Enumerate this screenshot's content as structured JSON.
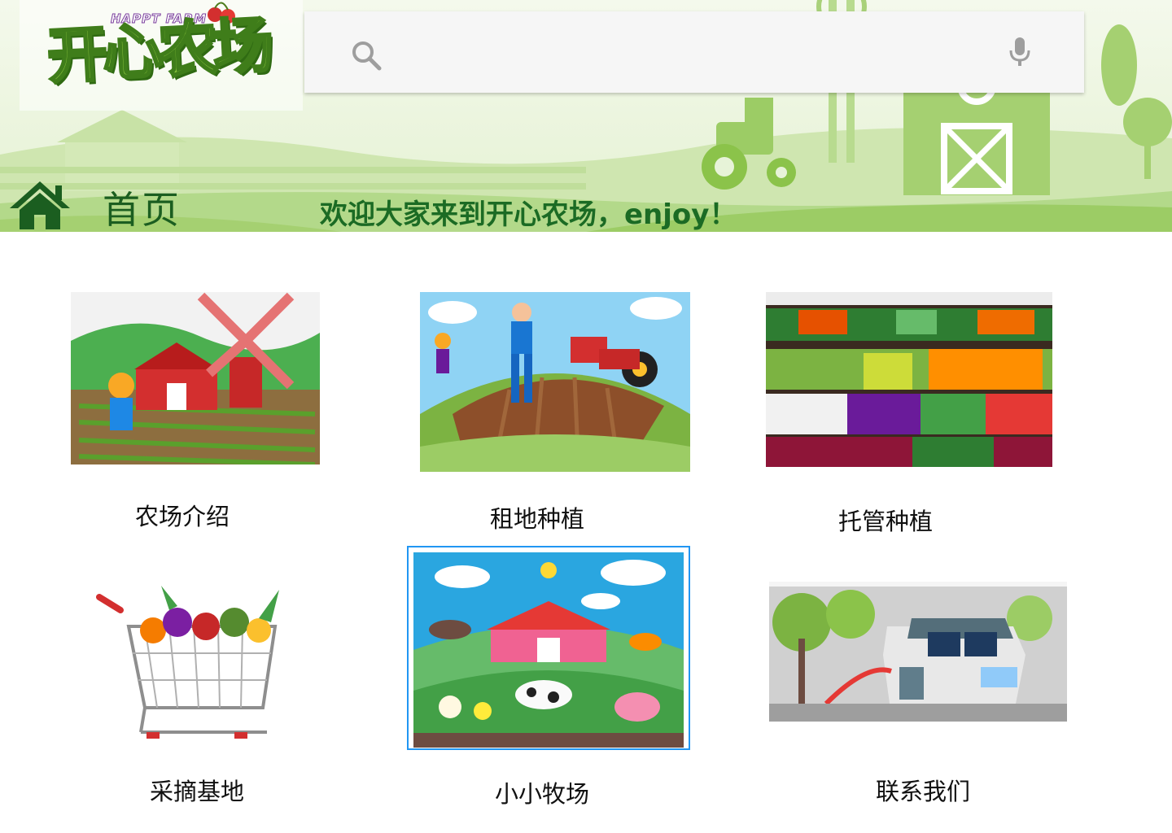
{
  "header": {
    "logo": {
      "title_cn": "开心农场",
      "title_en": "HAPPT FARM"
    },
    "search": {
      "value": "",
      "placeholder": ""
    },
    "nav_title": "首页",
    "welcome_text": "欢迎大家来到开心农场，enjoy！"
  },
  "tiles": [
    {
      "label": "农场介绍"
    },
    {
      "label": "租地种植"
    },
    {
      "label": "托管种植"
    },
    {
      "label": "采摘基地"
    },
    {
      "label": "小小牧场"
    },
    {
      "label": "联系我们"
    }
  ],
  "colors": {
    "banner_green": "#8bc34a",
    "title_green": "#1b5e20",
    "selection_border": "#2196f3"
  },
  "icons": [
    "search-icon",
    "microphone-icon",
    "home-icon"
  ]
}
